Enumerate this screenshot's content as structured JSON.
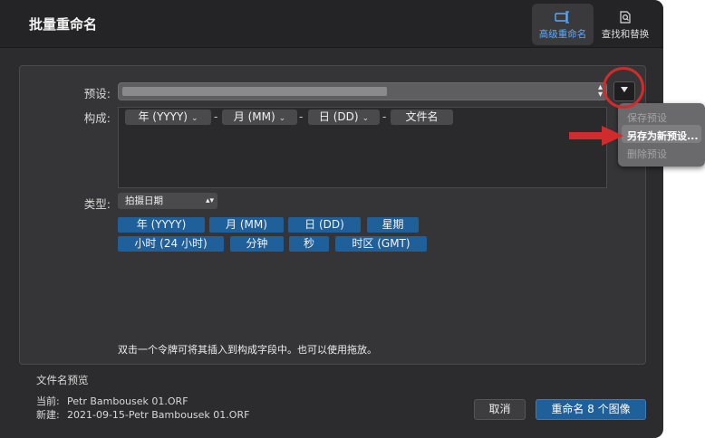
{
  "window": {
    "title": "批量重命名"
  },
  "toolbar": {
    "advanced_label": "高级重命名",
    "find_replace_label": "查找和替换"
  },
  "preset": {
    "label": "预设:"
  },
  "preset_menu": {
    "items": [
      {
        "label": "保存预设",
        "enabled": false
      },
      {
        "label": "另存为新预设...",
        "enabled": true,
        "highlighted": true
      },
      {
        "label": "删除预设",
        "enabled": false
      }
    ]
  },
  "composition": {
    "label": "构成:",
    "tokens": [
      {
        "label": "年 (YYYY)",
        "has_menu": true
      },
      {
        "label": "月 (MM)",
        "has_menu": true
      },
      {
        "label": "日 (DD)",
        "has_menu": true
      },
      {
        "label": "文件名",
        "has_menu": false
      }
    ],
    "separator": "-"
  },
  "type": {
    "label": "类型:",
    "selected": "拍摄日期"
  },
  "palette": {
    "row1": [
      "年 (YYYY)",
      "月 (MM)",
      "日 (DD)",
      "星期"
    ],
    "row2": [
      "小时 (24 小时)",
      "分钟",
      "秒",
      "时区 (GMT)"
    ]
  },
  "hint": "双击一个令牌可将其插入到构成字段中。也可以使用拖放。",
  "preview": {
    "title": "文件名预览",
    "current_label": "当前:",
    "current_value": "Petr Bambousek 01.ORF",
    "new_label": "新建:",
    "new_value": "2021-09-15-Petr Bambousek 01.ORF"
  },
  "buttons": {
    "cancel": "取消",
    "rename": "重命名 8 个图像"
  },
  "colors": {
    "accent": "#1f5f9a",
    "annotation": "#d22b2b",
    "window_bg": "#2c2c2e"
  }
}
